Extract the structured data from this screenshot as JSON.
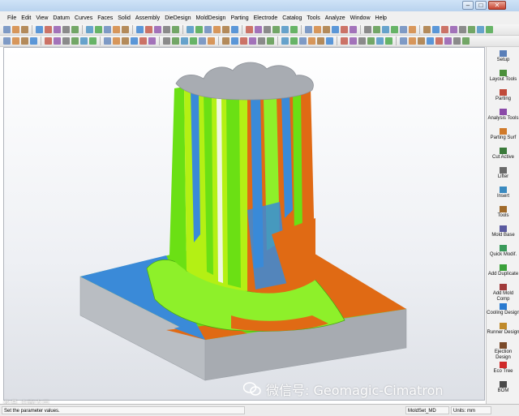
{
  "menubar": {
    "items": [
      "File",
      "Edit",
      "View",
      "Datum",
      "Curves",
      "Faces",
      "Solid",
      "Assembly",
      "DieDesign",
      "MoldDesign",
      "Parting",
      "Electrode",
      "Catalog",
      "Tools",
      "Analyze",
      "Window",
      "Help"
    ]
  },
  "window_controls": {
    "minimize": "–",
    "maximize": "□",
    "close": "✕"
  },
  "side_panel": {
    "items": [
      {
        "label": "Setup",
        "icon": "setup-icon",
        "color": "#5a7fb8"
      },
      {
        "label": "Layout Tools",
        "icon": "layout-tools-icon",
        "color": "#4a8f3a"
      },
      {
        "label": "Parting",
        "icon": "parting-icon",
        "color": "#c04a3a"
      },
      {
        "label": "Analysis Tools",
        "icon": "analysis-tools-icon",
        "color": "#8a4aa8"
      },
      {
        "label": "Parting Surf",
        "icon": "parting-surf-icon",
        "color": "#d07a2a"
      },
      {
        "label": "Cut Active",
        "icon": "cut-active-icon",
        "color": "#3a7a3a"
      },
      {
        "label": "Lifter",
        "icon": "lifter-icon",
        "color": "#6a6a6a"
      },
      {
        "label": "Insert",
        "icon": "insert-icon",
        "color": "#3a8ac0"
      },
      {
        "label": "Tools",
        "icon": "tools-icon",
        "color": "#a06a2a"
      },
      {
        "label": "Mold Base",
        "icon": "mold-base-icon",
        "color": "#5a5aa0"
      },
      {
        "label": "Quick Modif.",
        "icon": "quick-modif-icon",
        "color": "#3a9a5a"
      },
      {
        "label": "Add Duplicate",
        "icon": "add-duplicate-icon",
        "color": "#3aa03a"
      },
      {
        "label": "Add Mold Comp",
        "icon": "add-mold-comp-icon",
        "color": "#a03a3a"
      },
      {
        "label": "Cooling Design",
        "icon": "cooling-design-icon",
        "color": "#2a7ad0"
      },
      {
        "label": "Runner Design",
        "icon": "runner-design-icon",
        "color": "#c08a2a"
      },
      {
        "label": "Ejection Design",
        "icon": "ejection-design-icon",
        "color": "#7a4a2a"
      },
      {
        "label": "Eco Tree",
        "icon": "eco-tree-icon",
        "color": "#d02a2a"
      },
      {
        "label": "BOM",
        "icon": "bom-icon",
        "color": "#4a4a4a"
      }
    ]
  },
  "statusbar": {
    "message": "Set the parameter values.",
    "file": "MoldSet_MD",
    "units": "Units: mm"
  },
  "watermark": {
    "text": "微信号: Geomagic-Cimatron",
    "corner_text": "化品·大咖之日"
  },
  "model_colors": {
    "orange": "#e06a14",
    "green": "#6be014",
    "lime": "#b4f014",
    "blue": "#3a8ad8",
    "gray_top": "#a8acb2",
    "gray_side": "#b9bdc2"
  }
}
